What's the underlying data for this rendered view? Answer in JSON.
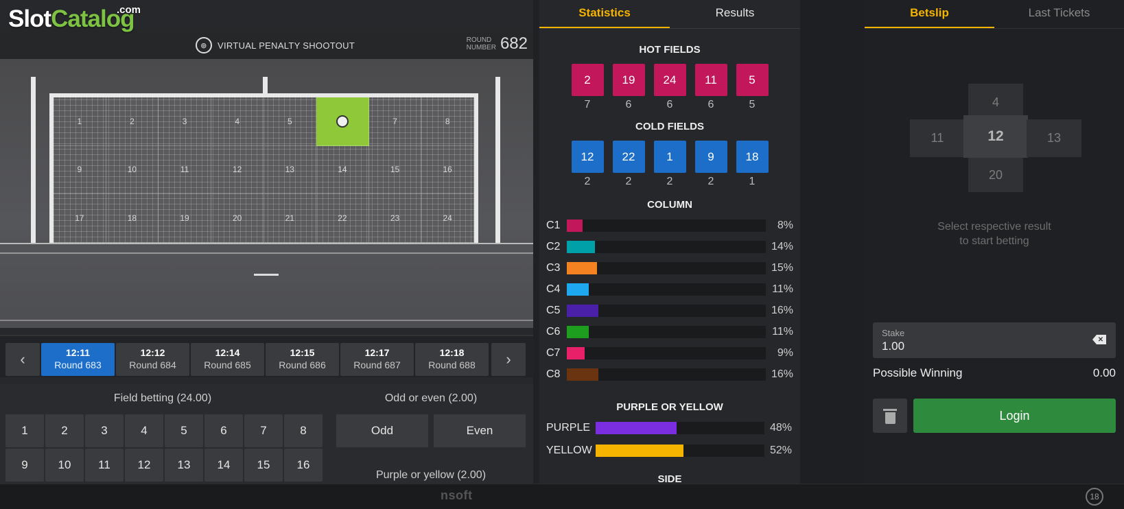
{
  "logo": {
    "slot": "Slot",
    "catalog": "Catalog",
    "com": ".com"
  },
  "game": {
    "title": "VIRTUAL PENALTY SHOOTOUT",
    "round_label_1": "ROUND",
    "round_label_2": "NUMBER",
    "round_number": "682"
  },
  "goal": {
    "cells": [
      "1",
      "2",
      "3",
      "4",
      "5",
      "",
      "7",
      "8",
      "9",
      "10",
      "11",
      "12",
      "13",
      "14",
      "15",
      "16",
      "17",
      "18",
      "19",
      "20",
      "21",
      "22",
      "23",
      "24"
    ],
    "hit_index": 5
  },
  "schedule": {
    "rounds": [
      {
        "time": "12:11",
        "round": "Round 683",
        "active": true
      },
      {
        "time": "12:12",
        "round": "Round 684",
        "active": false
      },
      {
        "time": "12:14",
        "round": "Round 685",
        "active": false
      },
      {
        "time": "12:15",
        "round": "Round 686",
        "active": false
      },
      {
        "time": "12:17",
        "round": "Round 687",
        "active": false
      },
      {
        "time": "12:18",
        "round": "Round 688",
        "active": false
      }
    ]
  },
  "betting": {
    "field_title": "Field betting (24.00)",
    "fields": [
      "1",
      "2",
      "3",
      "4",
      "5",
      "6",
      "7",
      "8",
      "9",
      "10",
      "11",
      "12",
      "13",
      "14",
      "15",
      "16"
    ],
    "odd_title": "Odd or even (2.00)",
    "odd": "Odd",
    "even": "Even",
    "py_title": "Purple or yellow (2.00)"
  },
  "stats": {
    "tab_statistics": "Statistics",
    "tab_results": "Results",
    "hot_title": "HOT FIELDS",
    "hot": [
      {
        "n": "2",
        "c": "7"
      },
      {
        "n": "19",
        "c": "6"
      },
      {
        "n": "24",
        "c": "6"
      },
      {
        "n": "11",
        "c": "6"
      },
      {
        "n": "5",
        "c": "5"
      }
    ],
    "cold_title": "COLD FIELDS",
    "cold": [
      {
        "n": "12",
        "c": "2"
      },
      {
        "n": "22",
        "c": "2"
      },
      {
        "n": "1",
        "c": "2"
      },
      {
        "n": "9",
        "c": "2"
      },
      {
        "n": "18",
        "c": "1"
      }
    ],
    "column_title": "COLUMN",
    "columns": [
      {
        "label": "C1",
        "pct": 8,
        "pct_text": "8%",
        "color": "#c2185b"
      },
      {
        "label": "C2",
        "pct": 14,
        "pct_text": "14%",
        "color": "#00a0a8"
      },
      {
        "label": "C3",
        "pct": 15,
        "pct_text": "15%",
        "color": "#f58220"
      },
      {
        "label": "C4",
        "pct": 11,
        "pct_text": "11%",
        "color": "#1ea8f0"
      },
      {
        "label": "C5",
        "pct": 16,
        "pct_text": "16%",
        "color": "#4a20a8"
      },
      {
        "label": "C6",
        "pct": 11,
        "pct_text": "11%",
        "color": "#1e9e1e"
      },
      {
        "label": "C7",
        "pct": 9,
        "pct_text": "9%",
        "color": "#e8206a"
      },
      {
        "label": "C8",
        "pct": 16,
        "pct_text": "16%",
        "color": "#6b3410"
      }
    ],
    "py_title": "PURPLE OR YELLOW",
    "purple": {
      "label": "PURPLE",
      "pct": 48,
      "pct_text": "48%",
      "color": "#7a2ee0"
    },
    "yellow": {
      "label": "YELLOW",
      "pct": 52,
      "pct_text": "52%",
      "color": "#f5b400"
    },
    "side_title": "SIDE"
  },
  "betslip": {
    "tab_betslip": "Betslip",
    "tab_last": "Last Tickets",
    "pad": {
      "top": "4",
      "left": "11",
      "center": "12",
      "right": "13",
      "bottom": "20"
    },
    "hint_1": "Select respective result",
    "hint_2": "to start betting",
    "stake_label": "Stake",
    "stake_value": "1.00",
    "possible_label": "Possible Winning",
    "possible_value": "0.00",
    "login": "Login"
  },
  "footer": {
    "brand": "nsoft",
    "age": "18"
  },
  "icons": {
    "round_logo": "penalty-logo-icon",
    "prev": "chevron-left-icon",
    "next": "chevron-right-icon",
    "clear": "backspace-icon",
    "trash": "trash-icon"
  }
}
